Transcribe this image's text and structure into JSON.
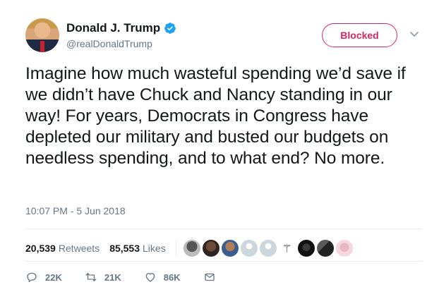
{
  "author": {
    "name": "Donald J. Trump",
    "handle": "@realDonaldTrump",
    "verified": true
  },
  "follow_button": {
    "label": "Blocked",
    "color": "#e0245e"
  },
  "tweet": {
    "text": "Imagine how much wasteful spending we’d save if we didn’t have Chuck and Nancy standing in our way! For years, Democrats in Congress have depleted our military and busted our budgets on needless spending, and to what end? No more.",
    "timestamp": "10:07 PM - 5 Jun 2018"
  },
  "stats": {
    "retweets_count": "20,539",
    "retweets_label": "Retweets",
    "likes_count": "85,553",
    "likes_label": "Likes"
  },
  "actions": {
    "reply_count": "22K",
    "retweet_count": "21K",
    "like_count": "86K"
  },
  "icons": [
    "verified-badge-icon",
    "chevron-down-icon",
    "reply-icon",
    "retweet-icon",
    "heart-icon",
    "message-icon"
  ]
}
